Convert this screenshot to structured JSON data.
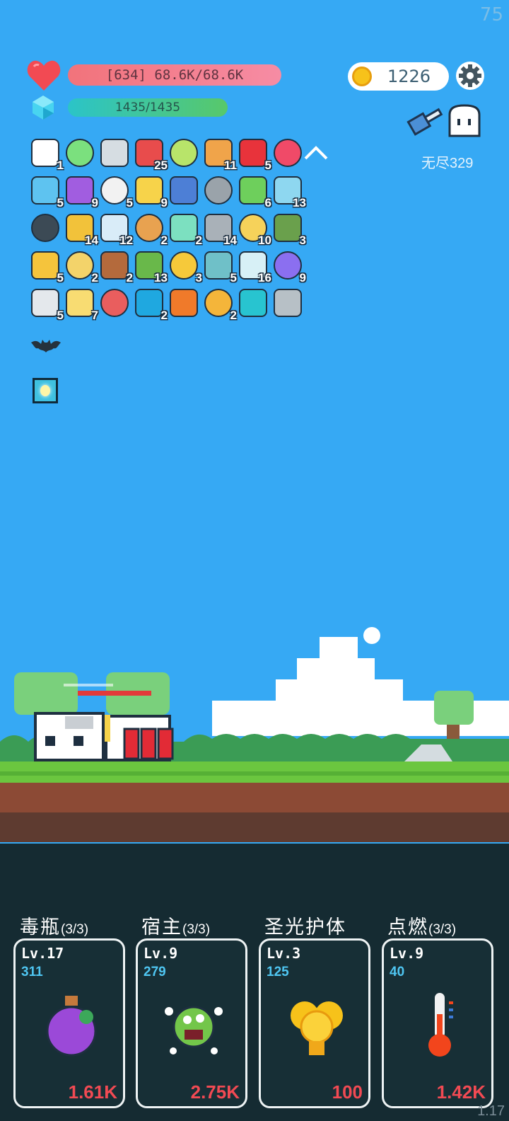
{
  "fps": "75",
  "version": "1.17",
  "player": {
    "hp_text": "[634] 68.6K/68.6K",
    "mp_text": "1435/1435"
  },
  "currency": {
    "coins": "1226"
  },
  "mode": {
    "label": "无尽329"
  },
  "colors": {
    "sky": "#36A9F4",
    "hp": "#F2737B",
    "mp": "#2BC4C8",
    "cost": "#F24A53",
    "level_value": "#4FC6F2"
  },
  "items": [
    {
      "icon": "star-card-icon",
      "count": "1"
    },
    {
      "icon": "biohazard-icon",
      "count": ""
    },
    {
      "icon": "sword-icon",
      "count": ""
    },
    {
      "icon": "mushroom-icon",
      "count": "25"
    },
    {
      "icon": "green-card-icon",
      "count": ""
    },
    {
      "icon": "briefcase-icon",
      "count": "11"
    },
    {
      "icon": "strawberry-icon",
      "count": "5"
    },
    {
      "icon": "ruby-icon",
      "count": ""
    },
    {
      "icon": "speech-bubble-icon",
      "count": "5"
    },
    {
      "icon": "crystal-ball-icon",
      "count": "9"
    },
    {
      "icon": "clipboard-icon",
      "count": "5"
    },
    {
      "icon": "cheese-icon",
      "count": "9"
    },
    {
      "icon": "cards-icon",
      "count": ""
    },
    {
      "icon": "viking-helmet-icon",
      "count": ""
    },
    {
      "icon": "slime-icon",
      "count": "6"
    },
    {
      "icon": "flask-icon",
      "count": "13"
    },
    {
      "icon": "bomb-icon",
      "count": ""
    },
    {
      "icon": "pineapple-icon",
      "count": "14"
    },
    {
      "icon": "shirt-icon",
      "count": "12"
    },
    {
      "icon": "meteor-icon",
      "count": "2"
    },
    {
      "icon": "ghost-spirit-icon",
      "count": "2"
    },
    {
      "icon": "dumbbell-icon",
      "count": "14"
    },
    {
      "icon": "sun-cloud-icon",
      "count": "10"
    },
    {
      "icon": "grenade-icon",
      "count": "3"
    },
    {
      "icon": "magic-wand-icon",
      "count": "5"
    },
    {
      "icon": "ring-icon",
      "count": "2"
    },
    {
      "icon": "cake-flag-icon",
      "count": "2"
    },
    {
      "icon": "turtle-shell-icon",
      "count": "13"
    },
    {
      "icon": "sunflower-icon",
      "count": "3"
    },
    {
      "icon": "disc-icon",
      "count": "5"
    },
    {
      "icon": "sparkles-icon",
      "count": "16"
    },
    {
      "icon": "gift-box-icon",
      "count": "9"
    },
    {
      "icon": "knight-helmet-icon",
      "count": "5"
    },
    {
      "icon": "notepad-icon",
      "count": "7"
    },
    {
      "icon": "percent-tag-icon",
      "count": ""
    },
    {
      "icon": "sapphire-icon",
      "count": "2"
    },
    {
      "icon": "fire-ring-icon",
      "count": ""
    },
    {
      "icon": "beer-mug-icon",
      "count": "2"
    },
    {
      "icon": "target-tile-icon",
      "count": ""
    },
    {
      "icon": "compass-icon",
      "count": ""
    }
  ],
  "skills": [
    {
      "name": "毒瓶",
      "uses": "(3/3)",
      "level": "Lv.17",
      "value": "311",
      "cost": "1.61K",
      "icon": "poison-bottle-icon"
    },
    {
      "name": "宿主",
      "uses": "(3/3)",
      "level": "Lv.9",
      "value": "279",
      "cost": "2.75K",
      "icon": "virus-monster-icon"
    },
    {
      "name": "圣光护体",
      "uses": "",
      "level": "Lv.3",
      "value": "125",
      "cost": "100",
      "icon": "holy-shield-icon"
    },
    {
      "name": "点燃",
      "uses": "(3/3)",
      "level": "Lv.9",
      "value": "40",
      "cost": "1.42K",
      "icon": "thermometer-icon"
    }
  ]
}
